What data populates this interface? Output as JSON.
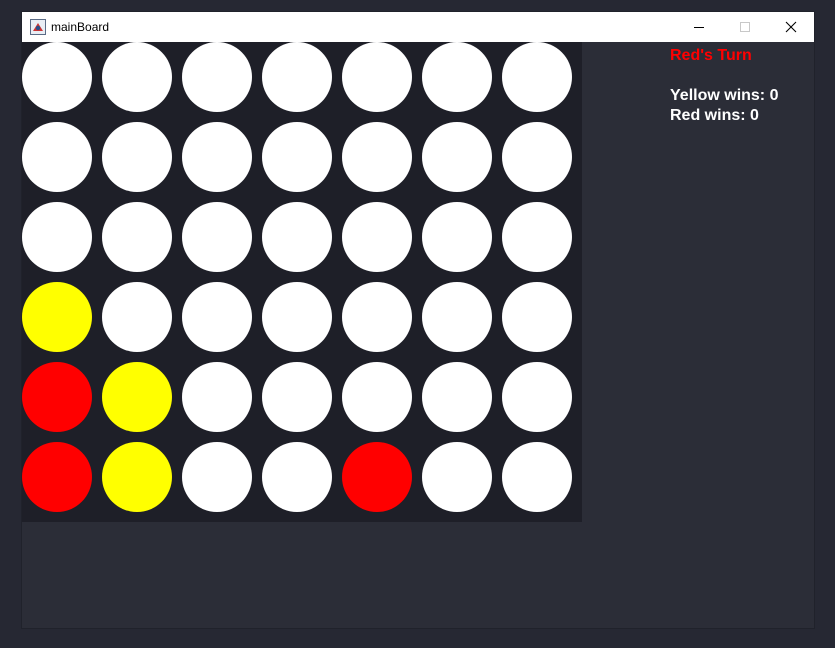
{
  "window": {
    "title": "mainBoard",
    "icon": "java-app-icon"
  },
  "status": {
    "turn_text": "Red's Turn",
    "turn_color": "#ff0000",
    "yellow_wins": "Yellow wins: 0",
    "red_wins": "Red wins: 0"
  },
  "colors": {
    "empty": "#ffffff",
    "red": "#ff0000",
    "yellow": "#ffff00",
    "board_background": "#1e1f28"
  },
  "board": {
    "columns": 7,
    "rows": 6,
    "cells": [
      [
        "empty",
        "empty",
        "empty",
        "empty",
        "empty",
        "empty",
        "empty"
      ],
      [
        "empty",
        "empty",
        "empty",
        "empty",
        "empty",
        "empty",
        "empty"
      ],
      [
        "empty",
        "empty",
        "empty",
        "empty",
        "empty",
        "empty",
        "empty"
      ],
      [
        "yellow",
        "empty",
        "empty",
        "empty",
        "empty",
        "empty",
        "empty"
      ],
      [
        "red",
        "yellow",
        "empty",
        "empty",
        "empty",
        "empty",
        "empty"
      ],
      [
        "red",
        "yellow",
        "empty",
        "empty",
        "red",
        "empty",
        "empty"
      ]
    ]
  }
}
